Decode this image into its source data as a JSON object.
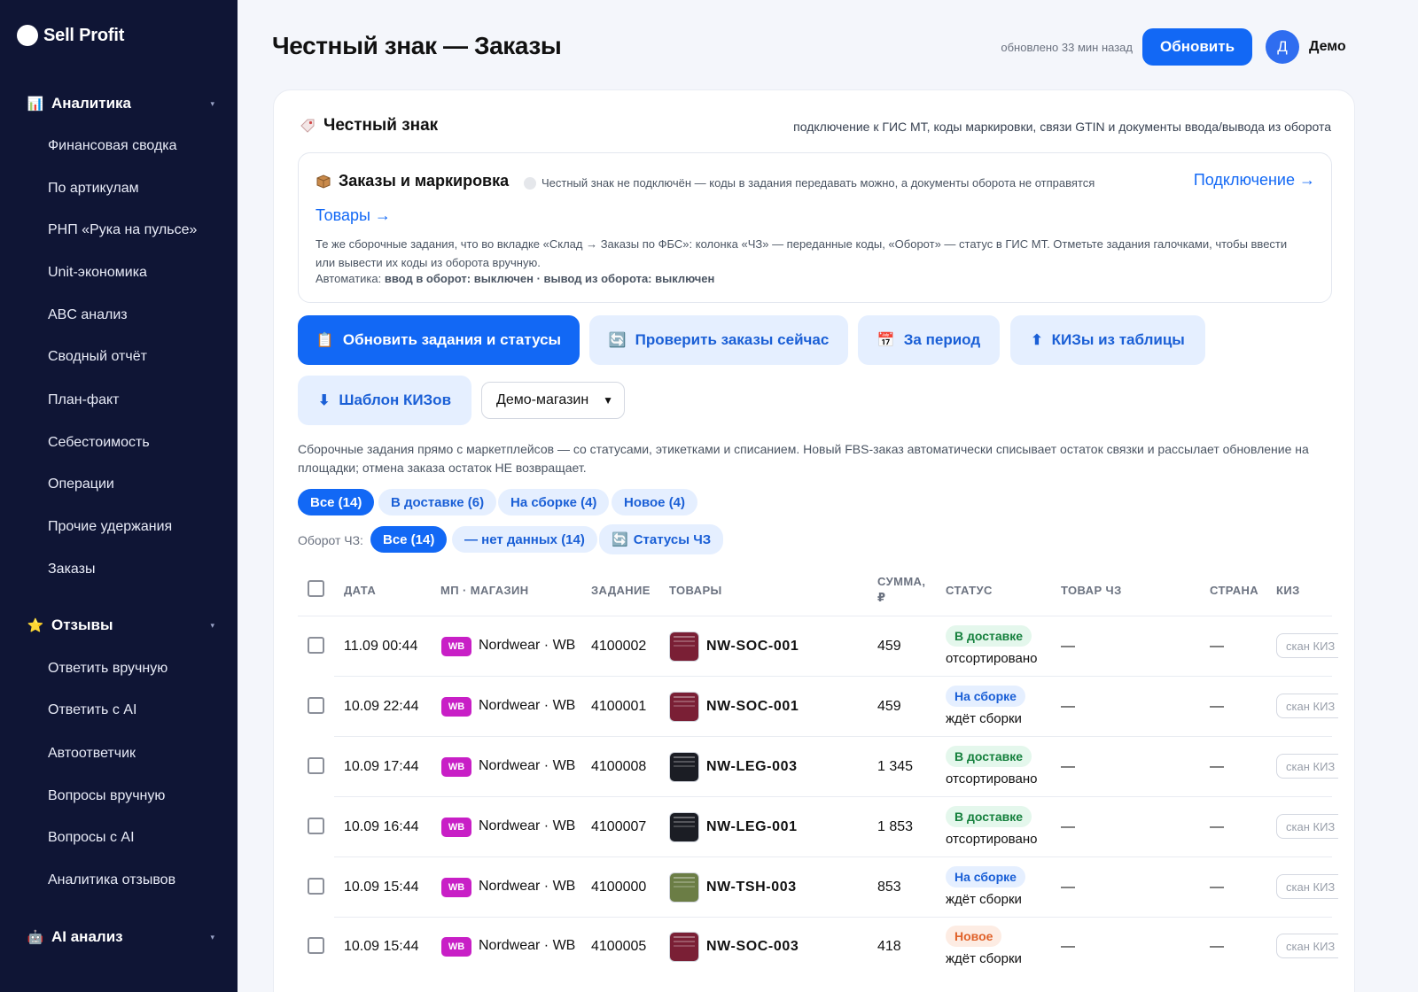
{
  "brand": {
    "name": "Sell Profit"
  },
  "sidebar": {
    "sections": [
      {
        "label": "Аналитика",
        "icon": "chart-icon",
        "glyph": "📊",
        "items": [
          "Финансовая сводка",
          "По артикулам",
          "РНП «Рука на пульсе»",
          "Unit-экономика",
          "ABC анализ",
          "Сводный отчёт",
          "План-факт",
          "Себестоимость",
          "Операции",
          "Прочие удержания",
          "Заказы"
        ]
      },
      {
        "label": "Отзывы",
        "icon": "star-icon",
        "glyph": "⭐",
        "items": [
          "Ответить вручную",
          "Ответить с AI",
          "Автоответчик",
          "Вопросы вручную",
          "Вопросы с AI",
          "Аналитика отзывов"
        ]
      },
      {
        "label": "AI анализ",
        "icon": "robot-icon",
        "glyph": "🤖",
        "items": []
      }
    ]
  },
  "header": {
    "title": "Честный знак — Заказы",
    "updated": "обновлено 33 мин назад",
    "refresh_label": "Обновить",
    "avatar_letter": "Д",
    "user_name": "Демо"
  },
  "card": {
    "title": "Честный знак",
    "subtitle": "подключение к ГИС МТ, коды маркировки, связи GTIN и документы ввода/вывода из оборота",
    "inner": {
      "title": "Заказы и маркировка",
      "note": "Честный знак не подключён — коды в задания передавать можно, а документы оборота не отправятся",
      "connect_link": "Подключение →",
      "goods_link": "Товары →",
      "description": "Те же сборочные задания, что во вкладке «Склад → Заказы по ФБС»: колонка «ЧЗ» — переданные коды, «Оборот» — статус в ГИС МТ. Отметьте задания галочками, чтобы ввести или вывести их коды из оборота вручную.",
      "auto_prefix": "Автоматика:",
      "auto_value": "ввод в оборот: выключен · вывод из оборота: выключен"
    },
    "actions": {
      "update_tasks": "Обновить задания и статусы",
      "check_now": "Проверить заказы сейчас",
      "period": "За период",
      "kiz_from_table": "КИЗы из таблицы",
      "kiz_template": "Шаблон КИЗов"
    },
    "store_select": {
      "value": "Демо-магазин"
    },
    "help": "Сборочные задания прямо с маркетплейсов — со статусами, этикетками и списанием. Новый FBS-заказ автоматически списывает остаток связки и рассылает обновление на площадки; отмена заказа остаток НЕ возвращает.",
    "status_filters": [
      "Все (14)",
      "В доставке (6)",
      "На сборке (4)",
      "Новое (4)"
    ],
    "turnover_label": "Оборот ЧЗ:",
    "turnover_filters": [
      "Все (14)",
      "— нет данных (14)",
      "Статусы ЧЗ"
    ]
  },
  "table": {
    "columns": [
      "ДАТА",
      "МП · МАГАЗИН",
      "ЗАДАНИЕ",
      "ТОВАРЫ",
      "СУММА, ₽",
      "СТАТУС",
      "ТОВАР ЧЗ",
      "СТРАНА",
      "КИЗ"
    ],
    "scan_placeholder": "скан КИЗ",
    "rows": [
      {
        "date": "11.09 00:44",
        "mp": "WB",
        "store": "Nordwear · WB",
        "task": "4100002",
        "sku": "NW-SOC-001",
        "thumb_color": "#7a1f35",
        "sum": "459",
        "status": "В доставке",
        "status_kind": "green",
        "substatus": "отсортировано",
        "good_cz": "—",
        "country": "—"
      },
      {
        "date": "10.09 22:44",
        "mp": "WB",
        "store": "Nordwear · WB",
        "task": "4100001",
        "sku": "NW-SOC-001",
        "thumb_color": "#7a1f35",
        "sum": "459",
        "status": "На сборке",
        "status_kind": "blue",
        "substatus": "ждёт сборки",
        "good_cz": "—",
        "country": "—"
      },
      {
        "date": "10.09 17:44",
        "mp": "WB",
        "store": "Nordwear · WB",
        "task": "4100008",
        "sku": "NW-LEG-003",
        "thumb_color": "#1b1d24",
        "sum": "1 345",
        "status": "В доставке",
        "status_kind": "green",
        "substatus": "отсортировано",
        "good_cz": "—",
        "country": "—"
      },
      {
        "date": "10.09 16:44",
        "mp": "WB",
        "store": "Nordwear · WB",
        "task": "4100007",
        "sku": "NW-LEG-001",
        "thumb_color": "#1b1d24",
        "sum": "1 853",
        "status": "В доставке",
        "status_kind": "green",
        "substatus": "отсортировано",
        "good_cz": "—",
        "country": "—"
      },
      {
        "date": "10.09 15:44",
        "mp": "WB",
        "store": "Nordwear · WB",
        "task": "4100000",
        "sku": "NW-TSH-003",
        "thumb_color": "#6b7d45",
        "sum": "853",
        "status": "На сборке",
        "status_kind": "blue",
        "substatus": "ждёт сборки",
        "good_cz": "—",
        "country": "—"
      },
      {
        "date": "10.09 15:44",
        "mp": "WB",
        "store": "Nordwear · WB",
        "task": "4100005",
        "sku": "NW-SOC-003",
        "thumb_color": "#7a1f35",
        "sum": "418",
        "status": "Новое",
        "status_kind": "orange",
        "substatus": "ждёт сборки",
        "good_cz": "—",
        "country": "—"
      }
    ]
  }
}
